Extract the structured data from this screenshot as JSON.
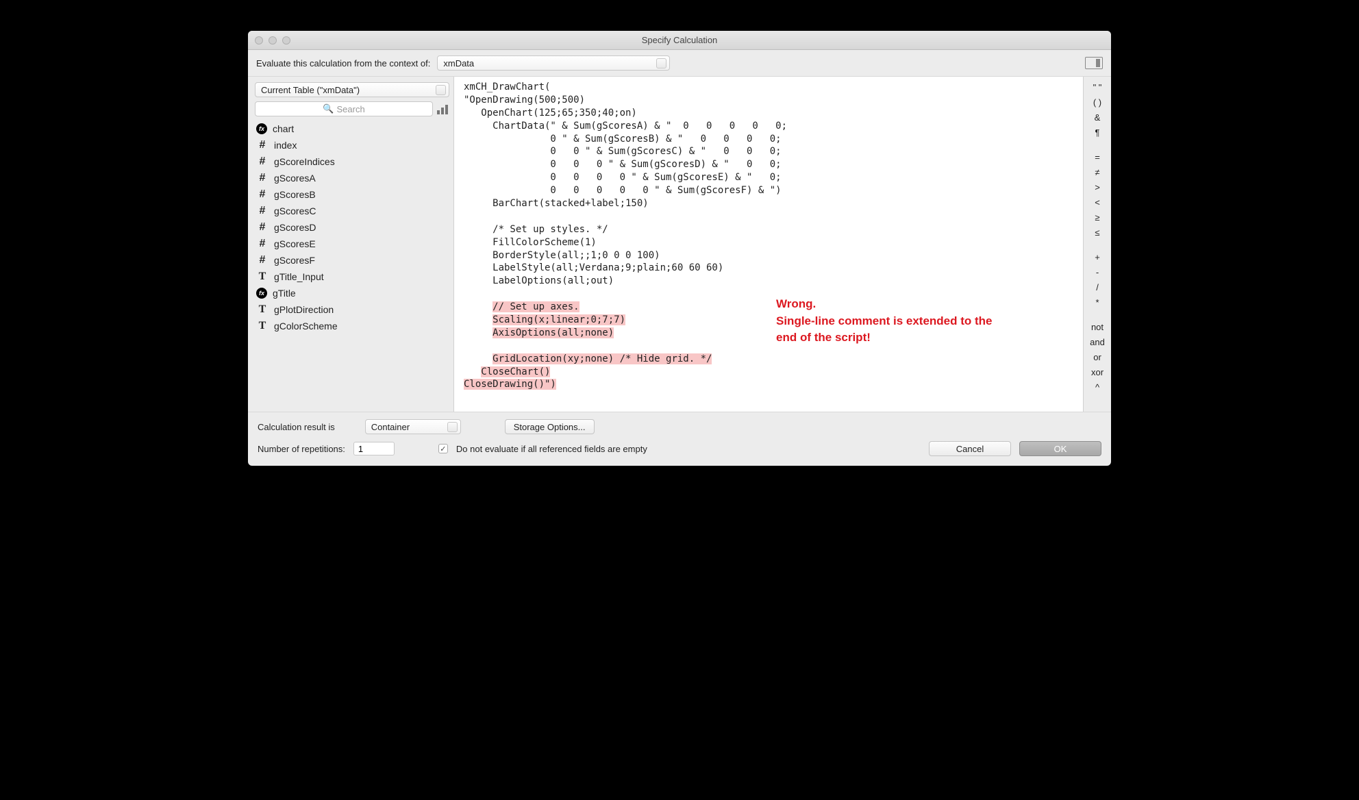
{
  "window_title": "Specify Calculation",
  "context_label": "Evaluate this calculation from the context of:",
  "context_value": "xmData",
  "table_select": "Current Table (\"xmData\")",
  "search_placeholder": "Search",
  "fields": [
    {
      "icon": "fx",
      "name": "chart"
    },
    {
      "icon": "hash",
      "name": "index"
    },
    {
      "icon": "hash",
      "name": "gScoreIndices"
    },
    {
      "icon": "hash",
      "name": "gScoresA"
    },
    {
      "icon": "hash",
      "name": "gScoresB"
    },
    {
      "icon": "hash",
      "name": "gScoresC"
    },
    {
      "icon": "hash",
      "name": "gScoresD"
    },
    {
      "icon": "hash",
      "name": "gScoresE"
    },
    {
      "icon": "hash",
      "name": "gScoresF"
    },
    {
      "icon": "t",
      "name": "gTitle_Input"
    },
    {
      "icon": "fx",
      "name": "gTitle"
    },
    {
      "icon": "t",
      "name": "gPlotDirection"
    },
    {
      "icon": "t",
      "name": "gColorScheme"
    }
  ],
  "code_plain": "xmCH_DrawChart(\n\"OpenDrawing(500;500)\n   OpenChart(125;65;350;40;on)\n     ChartData(\" & Sum(gScoresA) & \"  0   0   0   0   0;\n               0 \" & Sum(gScoresB) & \"   0   0   0   0;\n               0   0 \" & Sum(gScoresC) & \"   0   0   0;\n               0   0   0 \" & Sum(gScoresD) & \"   0   0;\n               0   0   0   0 \" & Sum(gScoresE) & \"   0;\n               0   0   0   0   0 \" & Sum(gScoresF) & \")\n     BarChart(stacked+label;150)\n\n     /* Set up styles. */\n     FillColorScheme(1)\n     BorderStyle(all;;1;0 0 0 100)\n     LabelStyle(all;Verdana;9;plain;60 60 60)\n     LabelOptions(all;out)\n",
  "code_hl": [
    {
      "pad": "     ",
      "text": "// Set up axes."
    },
    {
      "pad": "     ",
      "text": "Scaling(x;linear;0;7;7)"
    },
    {
      "pad": "     ",
      "text": "AxisOptions(all;none)"
    },
    {
      "pad": "",
      "text": ""
    },
    {
      "pad": "     ",
      "text": "GridLocation(xy;none) /* Hide grid. */"
    },
    {
      "pad": "   ",
      "text": "CloseChart()"
    },
    {
      "pad": "",
      "text": "CloseDrawing()\")"
    }
  ],
  "annotation": "Wrong.\nSingle-line comment is extended to the end of the script!",
  "operators": [
    "\" \"",
    "( )",
    "&",
    "¶",
    "",
    "=",
    "≠",
    ">",
    "<",
    "≥",
    "≤",
    "",
    "+",
    "-",
    "/",
    "*",
    "",
    "not",
    "and",
    "or",
    "xor",
    "^"
  ],
  "result_label": "Calculation result is",
  "result_value": "Container",
  "storage_btn": "Storage Options...",
  "reps_label": "Number of repetitions:",
  "reps_value": "1",
  "no_eval_label": "Do not evaluate if all referenced fields are empty",
  "cancel": "Cancel",
  "ok": "OK"
}
